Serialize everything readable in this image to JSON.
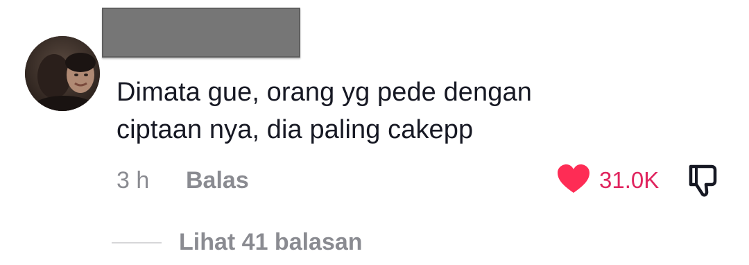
{
  "comment": {
    "text_line1": "Dimata gue, orang yg pede dengan",
    "text_line2": "ciptaan nya, dia paling cakepp",
    "time": "3 h",
    "reply_label": "Balas",
    "like_count": "31.0K",
    "liked": true,
    "view_replies_label": "Lihat 41 balasan"
  },
  "icons": {
    "like": "heart-icon",
    "dislike": "thumbs-down-icon"
  },
  "colors": {
    "text": "#161823",
    "muted": "#8a8b91",
    "like_red": "#fe2c55",
    "redaction_gray": "#767676"
  }
}
